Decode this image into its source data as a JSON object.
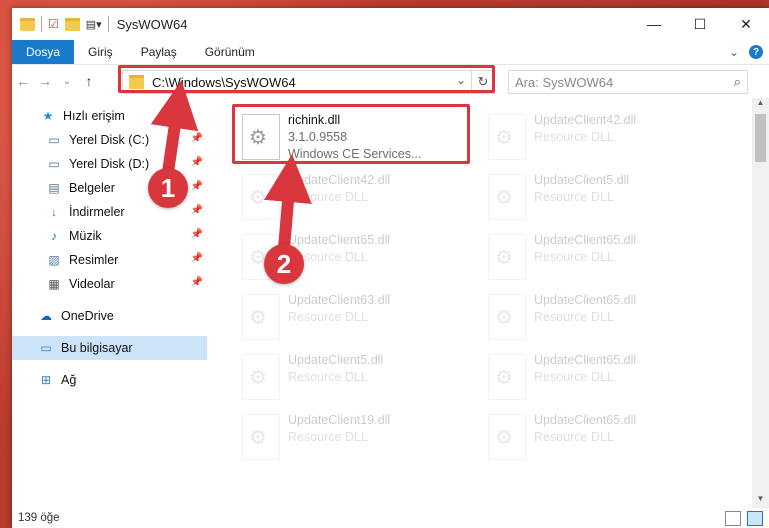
{
  "window": {
    "title": "SysWOW64",
    "minimize": "—",
    "maximize": "☐",
    "close": "✕"
  },
  "ribbon": {
    "tabs": [
      {
        "label": "Dosya",
        "active": true
      },
      {
        "label": "Giriş"
      },
      {
        "label": "Paylaş"
      },
      {
        "label": "Görünüm"
      }
    ],
    "expand": "⌄",
    "help": "?"
  },
  "nav": {
    "back": "←",
    "forward": "→",
    "recent": "⌄",
    "up": "↑",
    "address": "C:\\Windows\\SysWOW64",
    "address_dropdown": "⌄",
    "refresh": "↻",
    "search_placeholder": "Ara: SysWOW64",
    "search_icon": "⌕"
  },
  "sidebar": {
    "items": [
      {
        "label": "Hızlı erişim",
        "icon": "star-icon",
        "glyph": "★",
        "color": "#1e88e5",
        "pinned": false
      },
      {
        "label": "Yerel Disk (C:)",
        "icon": "drive-icon",
        "glyph": "▭",
        "color": "#4a6e91",
        "pinned": true
      },
      {
        "label": "Yerel Disk (D:)",
        "icon": "drive-icon",
        "glyph": "▭",
        "color": "#4a6e91",
        "pinned": true
      },
      {
        "label": "Belgeler",
        "icon": "documents-icon",
        "glyph": "▤",
        "color": "#5b6f86",
        "pinned": true
      },
      {
        "label": "İndirmeler",
        "icon": "download-icon",
        "glyph": "↓",
        "color": "#1e73c6",
        "pinned": true
      },
      {
        "label": "Müzik",
        "icon": "music-icon",
        "glyph": "♪",
        "color": "#1e73c6",
        "pinned": true
      },
      {
        "label": "Resimler",
        "icon": "pictures-icon",
        "glyph": "▨",
        "color": "#4f7ea8",
        "pinned": true
      },
      {
        "label": "Videolar",
        "icon": "videos-icon",
        "glyph": "▦",
        "color": "#555555",
        "pinned": true
      },
      {
        "label": "OneDrive",
        "icon": "cloud-icon",
        "glyph": "☁",
        "color": "#1565c0",
        "pinned": false
      },
      {
        "label": "Bu bilgisayar",
        "icon": "computer-icon",
        "glyph": "▭",
        "color": "#3a7bc8",
        "pinned": false,
        "selected": true
      },
      {
        "label": "Ağ",
        "icon": "network-icon",
        "glyph": "⊞",
        "color": "#3a7bc8",
        "pinned": false
      }
    ],
    "pin_glyph": "📌"
  },
  "files": {
    "highlighted": {
      "name": "richink.dll",
      "version": "3.1.0.9558",
      "description": "Windows CE Services..."
    },
    "faded": [
      {
        "name": "UpdateClient42.dll",
        "desc": "Resource DLL"
      },
      {
        "name": "UpdateClient42.dll",
        "desc": "Resource DLL"
      },
      {
        "name": "UpdateClient5.dll",
        "desc": "Resource DLL"
      },
      {
        "name": "UpdateClient65.dll",
        "desc": "Resource DLL"
      },
      {
        "name": "UpdateClient65.dll",
        "desc": "Resource DLL"
      },
      {
        "name": "UpdateClient63.dll",
        "desc": "Resource DLL"
      },
      {
        "name": "UpdateClient65.dll",
        "desc": "Resource DLL"
      },
      {
        "name": "UpdateClient5.dll",
        "desc": "Resource DLL"
      },
      {
        "name": "UpdateClient65.dll",
        "desc": "Resource DLL"
      },
      {
        "name": "UpdateClient19.dll",
        "desc": "Resource DLL"
      },
      {
        "name": "UpdateClient65.dll",
        "desc": "Resource DLL"
      }
    ]
  },
  "status": {
    "count": "139 öğe"
  },
  "callouts": [
    "1",
    "2"
  ],
  "colors": {
    "accent": "#1979ca",
    "highlight": "#d9363e"
  }
}
